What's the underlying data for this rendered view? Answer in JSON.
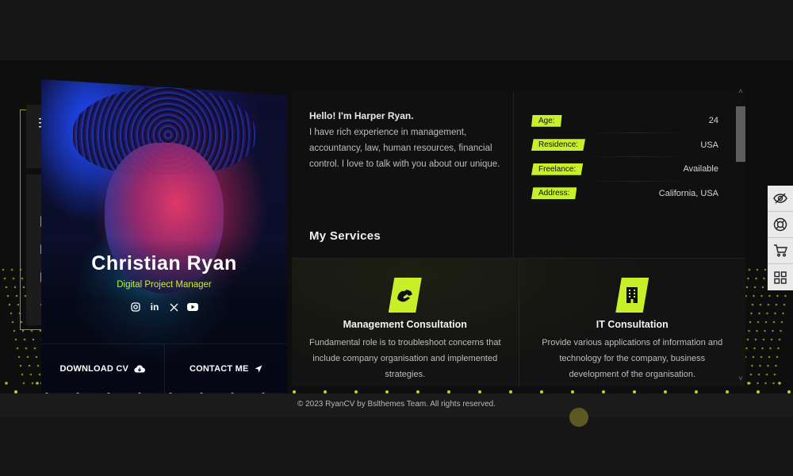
{
  "profile": {
    "name": "Christian Ryan",
    "role": "Digital Project Manager",
    "socials": [
      {
        "icon": "instagram-icon",
        "glyph": "◎"
      },
      {
        "icon": "linkedin-icon",
        "glyph": "in"
      },
      {
        "icon": "x-twitter-icon",
        "glyph": "𝕏"
      },
      {
        "icon": "youtube-icon",
        "glyph": "▶"
      }
    ],
    "download_label": "DOWNLOAD CV",
    "contact_label": "CONTACT ME"
  },
  "nav": {
    "top": [
      "menu-icon",
      "sun-icon"
    ],
    "items": [
      "about-icon",
      "resume-icon",
      "portfolio-icon",
      "blog-icon",
      "contact-icon"
    ],
    "active": "about-icon"
  },
  "about": {
    "hello": "Hello! I'm Harper Ryan.",
    "text": "I have rich experience in management, accountancy, law, human resources, financial control. I love to talk with you about our unique."
  },
  "info": [
    {
      "label": "Age:",
      "value": "24"
    },
    {
      "label": "Residence:",
      "value": "USA"
    },
    {
      "label": "Freelance:",
      "value": "Available"
    },
    {
      "label": "Address:",
      "value": "California, USA"
    }
  ],
  "services": {
    "title": "My Services",
    "items": [
      {
        "icon": "handshake-icon",
        "title": "Management Consultation",
        "desc": "Fundamental role is to troubleshoot concerns that include company organisation and implemented strategies."
      },
      {
        "icon": "building-icon",
        "title": "IT Consultation",
        "desc": "Provide various applications of information and technology for the company, business development of the organisation."
      }
    ]
  },
  "scroll": {
    "up": "˄",
    "down": "˅"
  },
  "rail": [
    "hide-icon",
    "support-icon",
    "cart-icon",
    "grid-icon"
  ],
  "footer": {
    "copyright": "© 2023 RyanCV by Bslthemes Team. All rights reserved."
  },
  "colors": {
    "accent": "#c7f02a",
    "background": "#111111",
    "panel": "#101010"
  }
}
